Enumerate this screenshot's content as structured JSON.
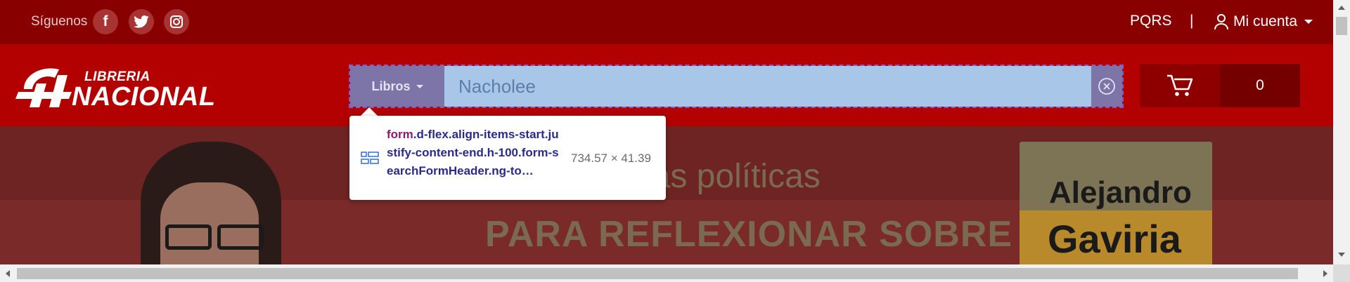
{
  "topbar": {
    "follow_label": "Síguenos",
    "social": [
      {
        "icon": "facebook-icon",
        "glyph": "f"
      },
      {
        "icon": "twitter-icon",
        "glyph": "t"
      },
      {
        "icon": "instagram-icon",
        "glyph": "◎"
      }
    ],
    "pqrs": "PQRS",
    "separator": "|",
    "account": "Mi cuenta"
  },
  "header": {
    "logo_small": "LIBRERIA",
    "logo_big": "NACIONAL",
    "search": {
      "category": "Libros",
      "value": "Nacholee"
    },
    "cart_count": "0"
  },
  "banner": {
    "line1": "rias políticas",
    "line2": "PARA REFLEXIONAR SOBRE",
    "book_title_1": "Alejandro",
    "book_title_2": "Gaviria"
  },
  "tooltip": {
    "tag": "form",
    "selector": ".d-flex.align-items-start.justify-content-end.h-100.form-searchFormHeader.ng-to…",
    "dimensions": "734.57 × 41.39"
  },
  "colors": {
    "topbar": "#880000",
    "header": "#b30000",
    "cart": "#8e0000",
    "search_highlight": "#a7c6e8"
  }
}
